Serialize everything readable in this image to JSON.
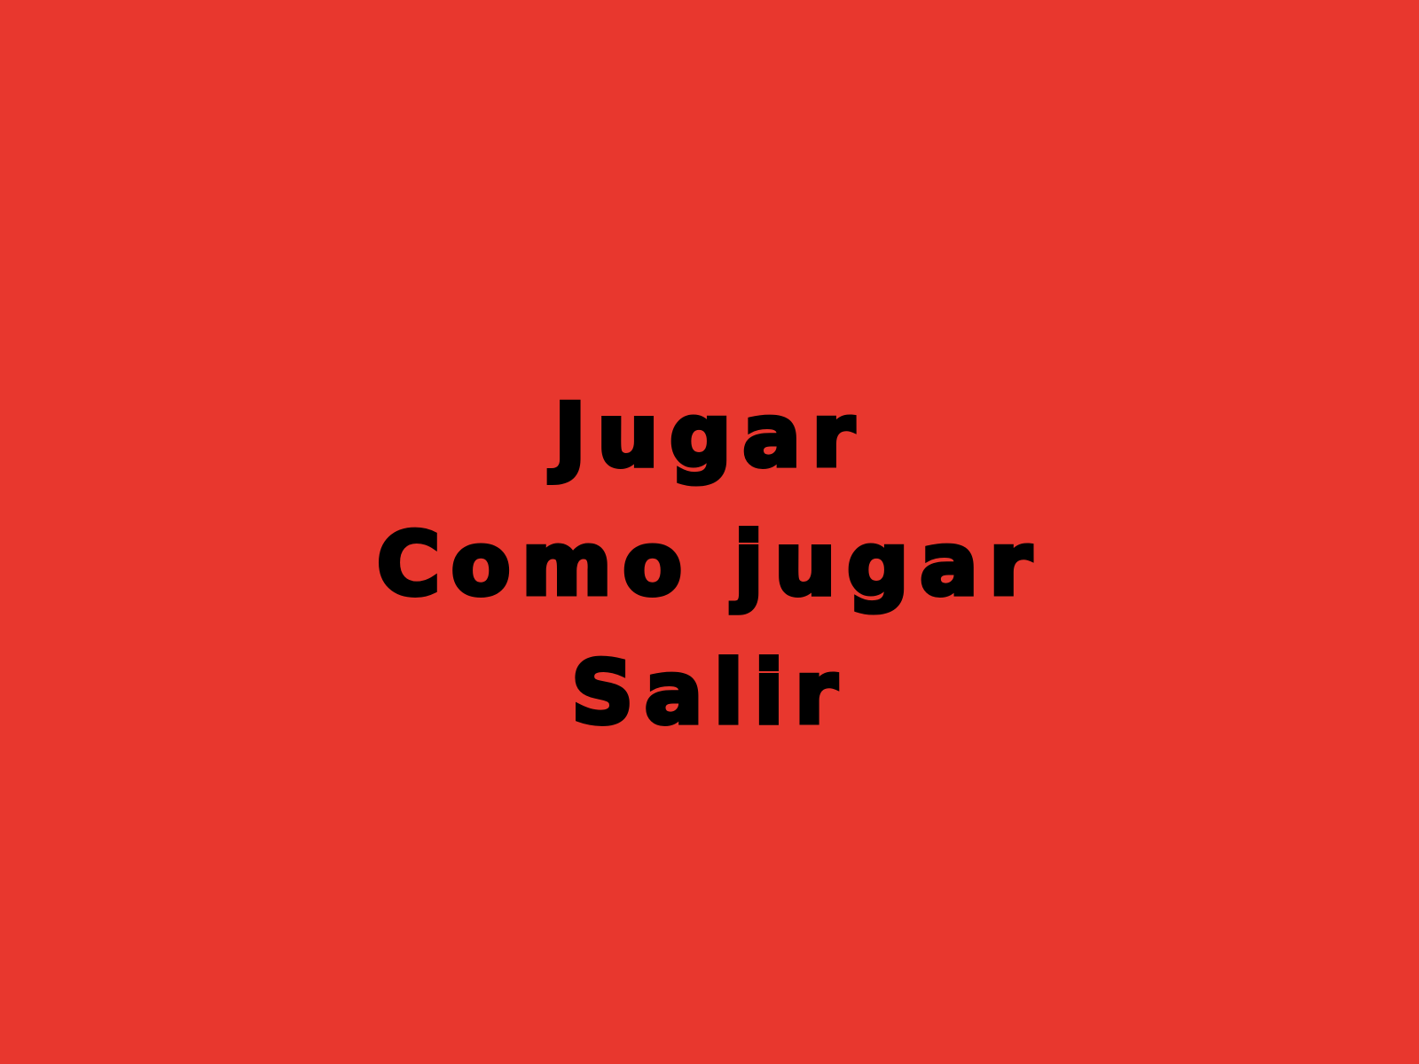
{
  "theme": {
    "background": "#e8372e",
    "text_color": "#000000"
  },
  "menu": {
    "items": [
      {
        "label": "Jugar"
      },
      {
        "label": "Como jugar"
      },
      {
        "label": "Salir"
      }
    ]
  }
}
